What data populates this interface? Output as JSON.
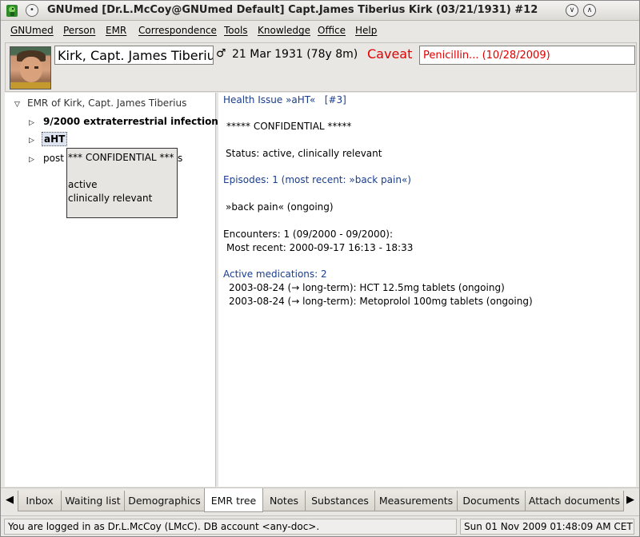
{
  "window": {
    "title": "GNUmed [Dr.L.McCoy@GNUmed Default] Capt.James Tiberius Kirk (03/21/1931) #12"
  },
  "menubar": {
    "items": [
      "GNUmed",
      "Person",
      "EMR",
      "Correspondence",
      "Tools",
      "Knowledge",
      "Office",
      "Help"
    ]
  },
  "patient": {
    "name": "Kirk, Capt. James Tiberius",
    "gender_symbol": "♂",
    "dob_age": "21 Mar 1931 (78y 8m)",
    "caveat_label": "Caveat",
    "allergy": "Penicillin... (10/28/2009)"
  },
  "tree": {
    "root": "EMR of Kirk, Capt. James Tiberius",
    "items": [
      {
        "label": "9/2000 extraterrestrial infection"
      },
      {
        "label": "aHT"
      },
      {
        "label": "post"
      }
    ],
    "tooltip_tail": "s",
    "tooltip": [
      "*** CONFIDENTIAL ***",
      "",
      "active",
      "clinically relevant"
    ]
  },
  "detail": {
    "header": "Health Issue »aHT«   [#3]",
    "confidential": "***** CONFIDENTIAL *****",
    "status": "Status: active, clinically relevant",
    "episodes": "Episodes: 1 (most recent: »back pain«)",
    "episode_item": "»back pain« (ongoing)",
    "encounters": "Encounters: 1 (09/2000 - 09/2000):",
    "most_recent": "Most recent: 2000-09-17 16:13 - 18:33",
    "active_meds": "Active medications: 2",
    "med1": "2003-08-24 (→ long-term): HCT 12.5mg tablets (ongoing)",
    "med2": "2003-08-24 (→ long-term): Metoprolol 100mg tablets (ongoing)"
  },
  "tabs": [
    "Inbox",
    "Waiting list",
    "Demographics",
    "EMR tree",
    "Notes",
    "Substances",
    "Measurements",
    "Documents",
    "Attach documents"
  ],
  "active_tab": "EMR tree",
  "status": {
    "left": "You are logged in as Dr.L.McCoy (LMcC). DB account <any-doc>.",
    "right": "Sun 01 Nov 2009 01:48:09 AM CET"
  },
  "icons": {
    "app": "gnumed-snake-icon",
    "window_menu": "window-menu-icon",
    "minimize": "minimize-icon",
    "maximize": "maximize-icon",
    "expand": "tree-expand-icon",
    "collapse": "tree-collapse-icon",
    "tab_left": "tab-scroll-left-icon",
    "tab_right": "tab-scroll-right-icon"
  },
  "colors": {
    "caveat": "#e00000",
    "link": "#1a3d8c",
    "selection": "#dde4f0"
  }
}
